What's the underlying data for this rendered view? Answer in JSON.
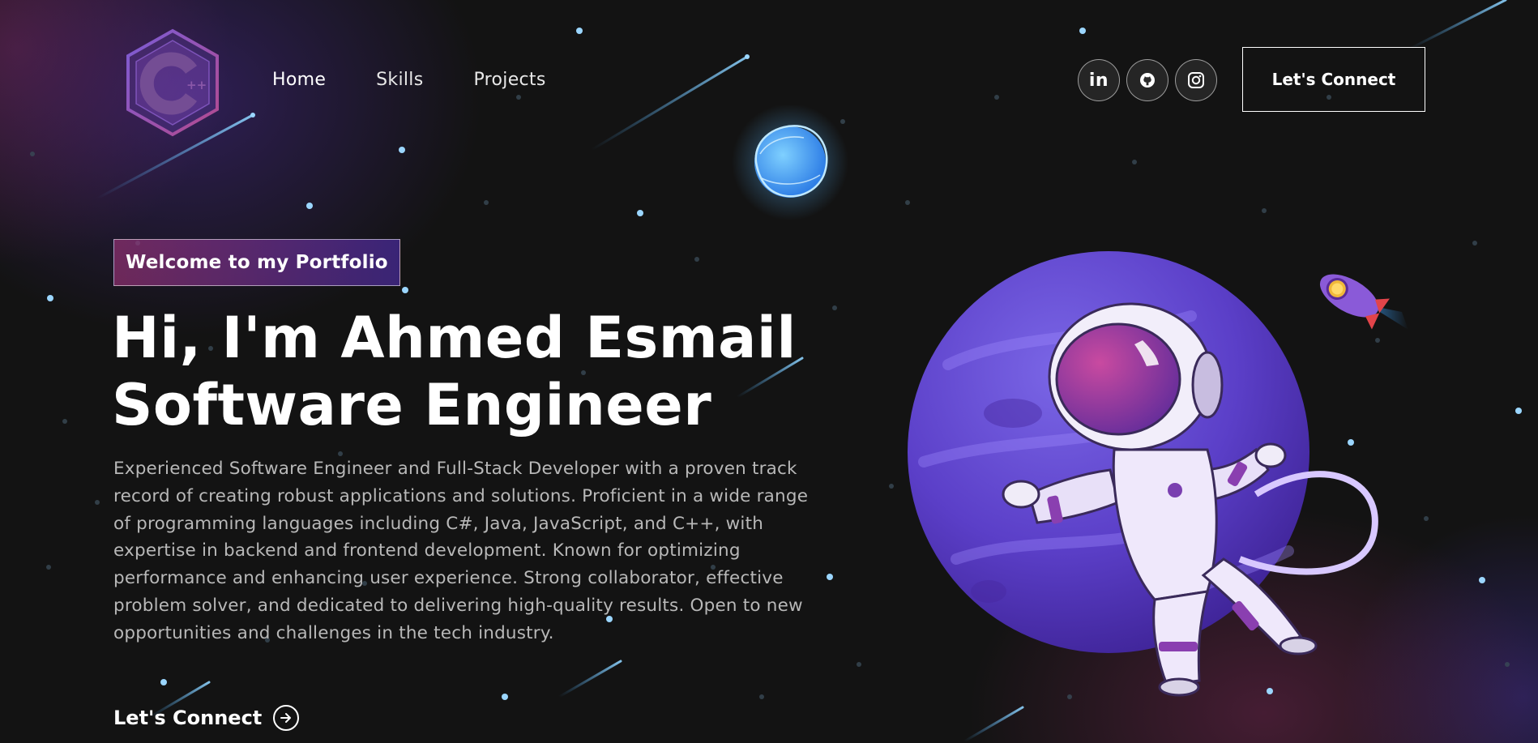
{
  "nav": {
    "logo_icon": "cpp-hexagon-logo",
    "links": [
      {
        "label": "Home",
        "active": true
      },
      {
        "label": "Skills",
        "active": false
      },
      {
        "label": "Projects",
        "active": false
      }
    ],
    "social": [
      {
        "name": "linkedin-icon",
        "glyph": "in"
      },
      {
        "name": "github-icon"
      },
      {
        "name": "instagram-icon"
      }
    ],
    "connect_label": "Let's Connect"
  },
  "hero": {
    "tagline": "Welcome to my Portfolio",
    "headline_line1": "Hi, I'm Ahmed Esmail",
    "headline_line2": "Software Engineer",
    "bio_lines": [
      "Experienced Software Engineer and Full-Stack Developer with a proven track",
      "record of creating robust applications and solutions. Proficient in a wide range",
      "of programming languages including C#, Java, JavaScript, and C++, with",
      "expertise in backend and frontend development. Known for optimizing",
      "performance and enhancing user experience. Strong collaborator, effective",
      "problem solver, and dedicated to delivering high-quality results. Open to new",
      "opportunities and challenges in the tech industry."
    ],
    "cta_label": "Let's Connect",
    "cta_icon": "arrow-right-circle-icon"
  },
  "illustration": {
    "astronaut": "astronaut-planet-illustration",
    "rocket": "rocket-icon",
    "small_planet": "blue-planet-icon"
  },
  "colors": {
    "background": "#131313",
    "accent_pink": "#AA367C",
    "accent_purple": "#4A2FBD",
    "planet_purple": "#6A4FD0",
    "text_muted": "#B8B8B8"
  }
}
